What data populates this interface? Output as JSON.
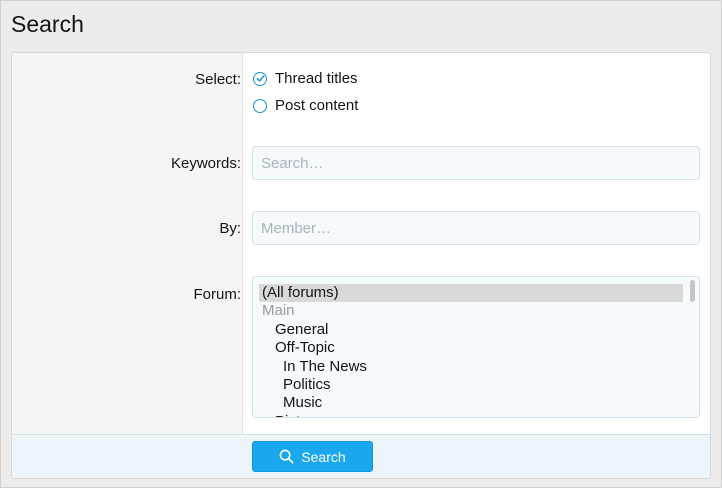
{
  "page": {
    "title": "Search"
  },
  "form": {
    "select": {
      "label": "Select:",
      "options": [
        {
          "label": "Thread titles",
          "checked": true
        },
        {
          "label": "Post content",
          "checked": false
        }
      ]
    },
    "keywords": {
      "label": "Keywords:",
      "placeholder": "Search…",
      "value": ""
    },
    "by": {
      "label": "By:",
      "placeholder": "Member…",
      "value": ""
    },
    "forum": {
      "label": "Forum:",
      "options": [
        {
          "label": "(All forums)",
          "selected": true,
          "group": false,
          "depth": 0
        },
        {
          "label": "Main",
          "selected": false,
          "group": true,
          "depth": 0
        },
        {
          "label": "General",
          "selected": false,
          "group": false,
          "depth": 1
        },
        {
          "label": "Off-Topic",
          "selected": false,
          "group": false,
          "depth": 1
        },
        {
          "label": "In The News",
          "selected": false,
          "group": false,
          "depth": 2
        },
        {
          "label": "Politics",
          "selected": false,
          "group": false,
          "depth": 2
        },
        {
          "label": "Music",
          "selected": false,
          "group": false,
          "depth": 2
        },
        {
          "label": "Pictures",
          "selected": false,
          "group": false,
          "depth": 1
        }
      ]
    }
  },
  "footer": {
    "search_label": "Search",
    "search_icon": "search-icon"
  },
  "colors": {
    "accent": "#1aa7ee",
    "radio_accent": "#1a8fd1",
    "input_background": "#f5fafd",
    "footer_background": "#edf5fb"
  }
}
